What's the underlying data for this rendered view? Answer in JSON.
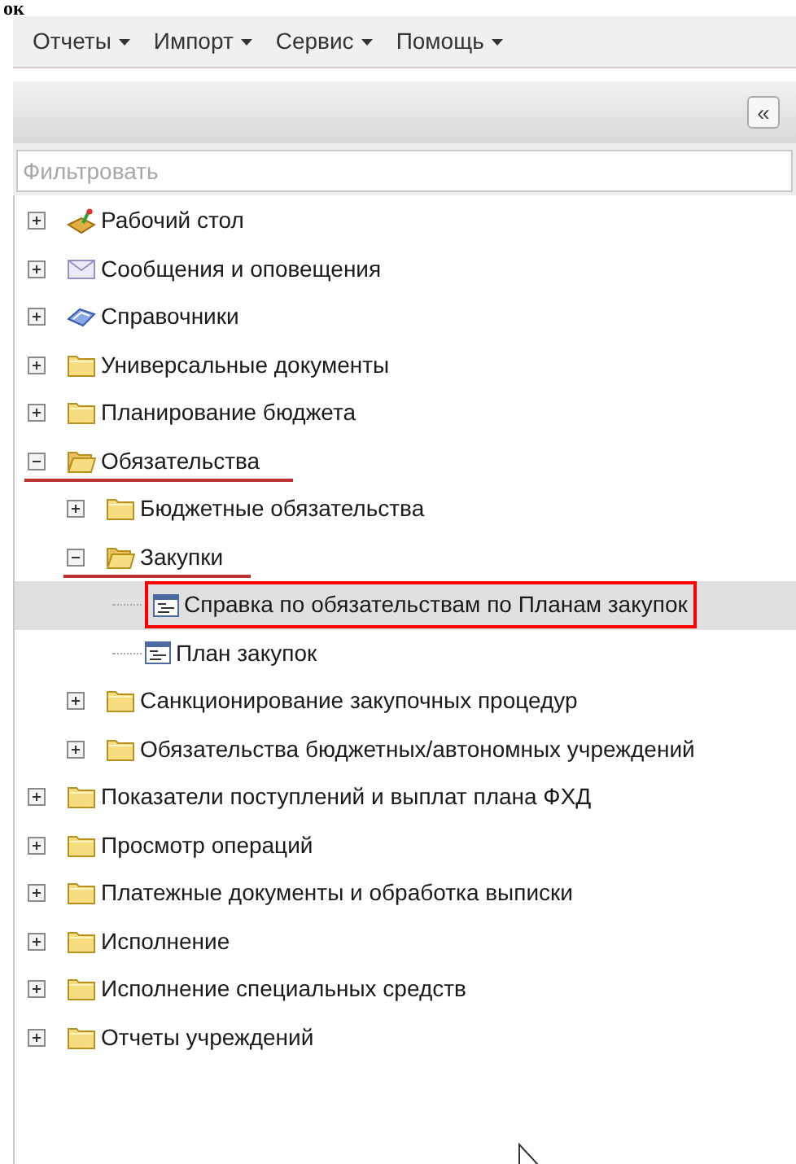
{
  "heading": "ок",
  "menu": [
    {
      "label": "Отчеты"
    },
    {
      "label": "Импорт"
    },
    {
      "label": "Сервис"
    },
    {
      "label": "Помощь"
    }
  ],
  "collapse_button": "«",
  "filter": {
    "placeholder": "Фильтровать"
  },
  "tree": [
    {
      "label": "Рабочий стол",
      "kind": "desktop",
      "expanded": false,
      "selected": false
    },
    {
      "label": "Сообщения и оповещения",
      "kind": "messages",
      "expanded": false,
      "selected": false
    },
    {
      "label": "Справочники",
      "kind": "reference",
      "expanded": false,
      "selected": false
    },
    {
      "label": "Универсальные документы",
      "kind": "folder",
      "expanded": false,
      "selected": false
    },
    {
      "label": "Планирование бюджета",
      "kind": "folder",
      "expanded": false,
      "selected": false
    },
    {
      "label": "Обязательства",
      "kind": "folder",
      "expanded": true,
      "selected": false,
      "underlined": true,
      "children": [
        {
          "label": "Бюджетные обязательства",
          "kind": "folder",
          "expanded": false,
          "selected": false
        },
        {
          "label": "Закупки",
          "kind": "folder",
          "expanded": true,
          "selected": false,
          "underlined": true,
          "children": [
            {
              "label": "Справка по обязательствам по Планам закупок",
              "kind": "report",
              "selected": true,
              "highlighted": true
            },
            {
              "label": "План закупок",
              "kind": "report",
              "selected": false
            }
          ]
        },
        {
          "label": "Санкционирование закупочных процедур",
          "kind": "folder",
          "expanded": false,
          "selected": false
        },
        {
          "label": "Обязательства бюджетных/автономных учреждений",
          "kind": "folder",
          "expanded": false,
          "selected": false
        }
      ]
    },
    {
      "label": "Показатели поступлений и выплат плана ФХД",
      "kind": "folder",
      "expanded": false,
      "selected": false
    },
    {
      "label": "Просмотр операций",
      "kind": "folder",
      "expanded": false,
      "selected": false
    },
    {
      "label": "Платежные документы и обработка выписки",
      "kind": "folder",
      "expanded": false,
      "selected": false
    },
    {
      "label": "Исполнение",
      "kind": "folder",
      "expanded": false,
      "selected": false
    },
    {
      "label": "Исполнение специальных средств",
      "kind": "folder",
      "expanded": false,
      "selected": false
    },
    {
      "label": "Отчеты учреждений",
      "kind": "folder",
      "expanded": false,
      "selected": false
    }
  ]
}
